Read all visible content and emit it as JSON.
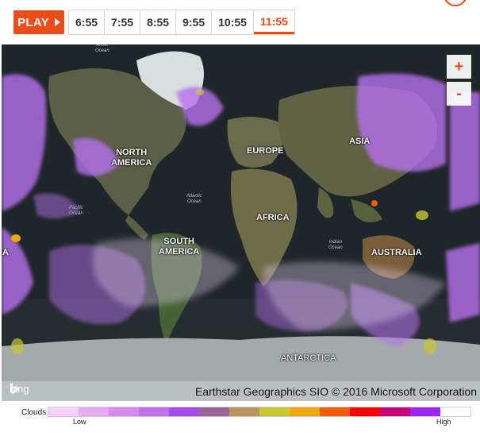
{
  "controls": {
    "play_label": "PLAY",
    "times": [
      "6:55",
      "7:55",
      "8:55",
      "9:55",
      "10:55",
      "11:55"
    ],
    "active_time": "11:55"
  },
  "map": {
    "regions": {
      "north_america": "NORTH\nAMERICA",
      "south_america": "SOUTH\nAMERICA",
      "europe": "EUROPE",
      "asia": "ASIA",
      "africa": "AFRICA",
      "australia": "AUSTRALIA",
      "antarctica": "ANTARCTICA",
      "edge_left": "IA"
    },
    "oceans": {
      "arctic": "Arctic\nOcean",
      "atlantic": "Atlantic\nOcean",
      "pacific": "Pacific\nOcean",
      "indian": "Indian\nOcean"
    },
    "zoom_in": "+",
    "zoom_out": "-",
    "bing_label": "bing",
    "attribution": "Earthstar Geographics SIO   © 2016 Microsoft Corporation"
  },
  "legend": {
    "label": "Clouds",
    "low": "Low",
    "high": "High",
    "colors": [
      "#f8cff8",
      "#e8a9f3",
      "#d68aed",
      "#c070e8",
      "#a54bea",
      "#996699",
      "#b8955c",
      "#c9c832",
      "#f0a70b",
      "#f55a07",
      "#f80000",
      "#c8007c",
      "#9d27f5",
      "#ffffff"
    ]
  },
  "colors": {
    "accent": "#ea4d1a"
  }
}
